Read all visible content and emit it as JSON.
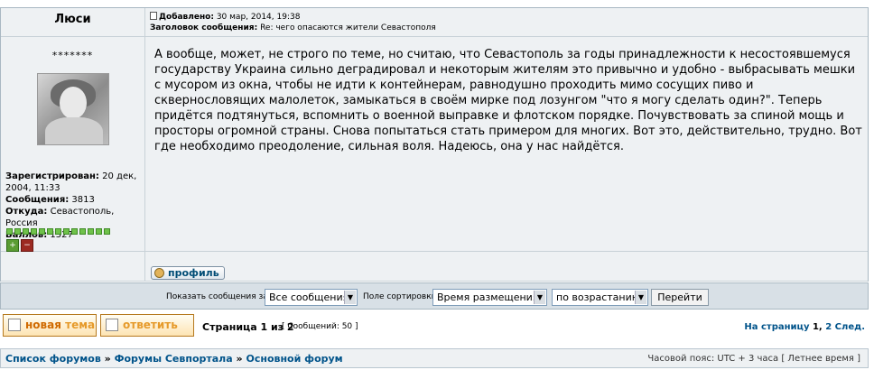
{
  "post": {
    "author": "Люси",
    "added_label": "Добавлено:",
    "added_date": "30 мар, 2014, 19:38",
    "subject_label": "Заголовок сообщения:",
    "subject": "Re: чего опасаются жители Севастополя",
    "rank": "*******",
    "registered_label": "Зарегистрирован:",
    "registered": "20 дек, 2004, 11:33",
    "messages_label": "Сообщения:",
    "messages": "3813",
    "from_label": "Откуда:",
    "from": "Севастополь, Россия",
    "points_label": "Баллов:",
    "points": "1527",
    "body": "А вообще, может, не строго по теме, но считаю, что Севастополь за годы принадлежности к несостоявшемуся государству Украина сильно деградировал и некоторым жителям это привычно и удобно - выбрасывать мешки с мусором из окна, чтобы не идти к контейнерам, равнодушно проходить мимо сосущих пиво и сквернословящих малолеток, замыкаться в своём мирке под лозунгом \"что я могу сделать один?\". Теперь придётся подтянуться, вспомнить о военной выправке и флотском порядке. Почувствовать за спиной мощь и просторы огромной страны. Снова попытаться стать примером для многих. Вот это, действительно, трудно. Вот где необходимо преодоление, сильная воля. Надеюсь, она у нас найдётся.",
    "profile_button": "профиль"
  },
  "sortbar": {
    "show_label": "Показать сообщения за:",
    "show_value": "Все сообщения",
    "sort_field_label": "Поле сортировки",
    "sort_field_value": "Время размещения",
    "order_value": "по возрастанию",
    "go_button": "Перейти"
  },
  "actions": {
    "new_topic_word1": "новая",
    "new_topic_word2": "тема",
    "reply": "ответить"
  },
  "pagination": {
    "page_info": "Страница 1 из 2",
    "posts_count": "[ Сообщений: 50 ]",
    "goto_label": "На страницу",
    "page1": "1",
    "comma": ",",
    "page2": "2",
    "next": "След."
  },
  "footer": {
    "crumb1": "Список форумов",
    "crumb2": "Форумы Севпортала",
    "crumb3": "Основной форум",
    "separator": "»",
    "timezone": "Часовой пояс: UTC + 3 часа [ Летнее время ]"
  },
  "colors": {
    "link": "#00538a",
    "button_text": "#d06a00",
    "panel_bg": "#eef1f3"
  }
}
